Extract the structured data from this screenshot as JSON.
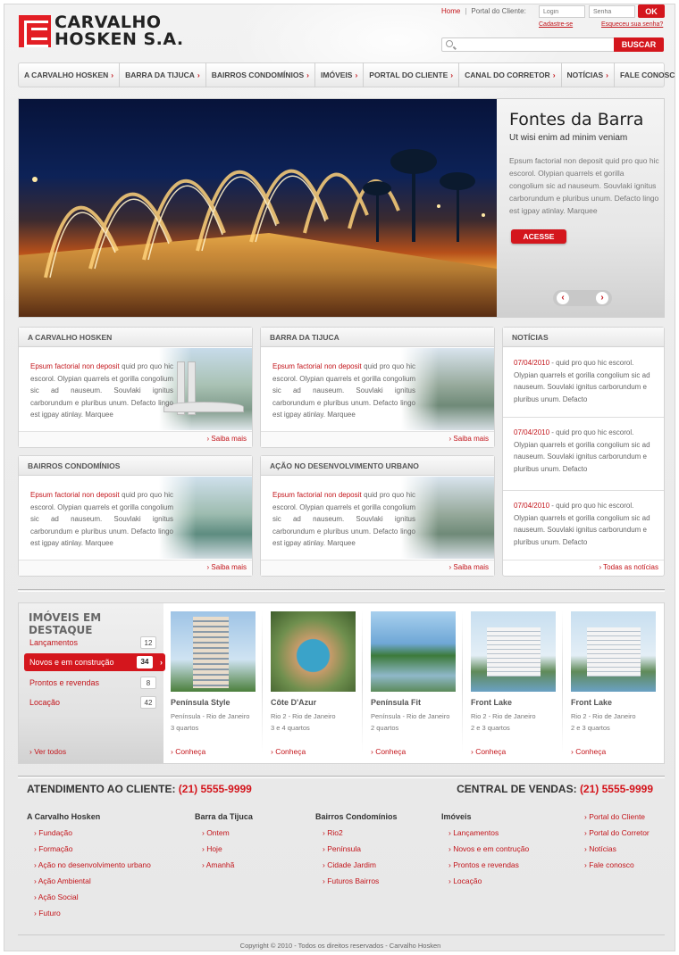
{
  "brand": {
    "line1": "CARVALHO",
    "line2": "HOSKEN S.A."
  },
  "top": {
    "home": "Home",
    "sep": "|",
    "portal_label": "Portal do Cliente:",
    "login_placeholder": "Login",
    "senha_placeholder": "Senha",
    "ok": "OK",
    "cadastre": "Cadastre-se",
    "esqueceu": "Esqueceu sua senha?"
  },
  "search": {
    "placeholder": "",
    "button": "BUSCAR"
  },
  "nav": [
    {
      "label": "A CARVALHO HOSKEN"
    },
    {
      "label": "BARRA DA TIJUCA"
    },
    {
      "label": "BAIRROS CONDOMÍNIOS"
    },
    {
      "label": "IMÓVEIS"
    },
    {
      "label": "PORTAL DO CLIENTE"
    },
    {
      "label": "CANAL DO CORRETOR"
    },
    {
      "label": "NOTÍCIAS"
    },
    {
      "label": "FALE CONOSCO"
    }
  ],
  "chevron": "›",
  "hero": {
    "title": "Fontes da Barra",
    "subtitle": "Ut wisi enim ad minim veniam",
    "text": "Epsum factorial non deposit quid pro quo hic escorol. Olypian quarrels et gorilla congolium sic ad nauseum. Souvlaki ignitus carborundum e pluribus unum. Defacto lingo est igpay atinlay. Marquee",
    "button": "ACESSE",
    "prev": "‹",
    "next": "›"
  },
  "boxes": [
    {
      "title": "A CARVALHO HOSKEN",
      "lead": "Epsum factorial non deposit",
      "text": " quid pro quo hic escorol. Olypian quarrels et gorilla congolium sic ad nauseum. Souvlaki ignitus carborundum e pluribus unum. Defacto lingo est igpay atinlay. Marquee",
      "link": "› Saiba mais"
    },
    {
      "title": "BARRA DA TIJUCA",
      "lead": "Epsum factorial non deposit",
      "text": " quid pro quo hic escorol. Olypian quarrels et gorilla congolium sic ad nauseum. Souvlaki ignitus carborundum e pluribus unum. Defacto lingo est igpay atinlay. Marquee",
      "link": "› Saiba mais"
    },
    {
      "title": "BAIRROS CONDOMÍNIOS",
      "lead": "Epsum factorial non deposit",
      "text": " quid pro quo hic escorol. Olypian quarrels et gorilla congolium sic ad nauseum. Souvlaki ignitus carborundum e pluribus unum. Defacto lingo est igpay atinlay. Marquee",
      "link": "› Saiba mais"
    },
    {
      "title": "AÇÃO NO DESENVOLVIMENTO URBANO",
      "lead": "Epsum factorial non deposit",
      "text": " quid pro quo hic escorol. Olypian quarrels et gorilla congolium sic ad nauseum. Souvlaki ignitus carborundum e pluribus unum. Defacto lingo est igpay atinlay. Marquee",
      "link": "› Saiba mais"
    }
  ],
  "noticias": {
    "title": "NOTÍCIAS",
    "items": [
      {
        "date": "07/04/2010",
        "text": " - quid pro quo hic escorol. Olypian quarrels et gorilla congolium sic ad nauseum. Souvlaki ignitus carborundum e pluribus unum. Defacto"
      },
      {
        "date": "07/04/2010",
        "text": " - quid pro quo hic escorol. Olypian quarrels et gorilla congolium sic ad nauseum. Souvlaki ignitus carborundum e pluribus unum. Defacto"
      },
      {
        "date": "07/04/2010",
        "text": " - quid pro quo hic escorol. Olypian quarrels et gorilla congolium sic ad nauseum. Souvlaki ignitus carborundum e pluribus unum. Defacto"
      }
    ],
    "link": "› Todas as notícias"
  },
  "destaque": {
    "title": "IMÓVEIS EM DESTAQUE",
    "categories": [
      {
        "label": "Lançamentos",
        "count": "12"
      },
      {
        "label": "Novos e em construção",
        "count": "34"
      },
      {
        "label": "Prontos e revendas",
        "count": "8"
      },
      {
        "label": "Locação",
        "count": "42"
      }
    ],
    "active_chevron": "›",
    "ver_todos": "› Ver todos",
    "properties": [
      {
        "name": "Península Style",
        "location": "Península - Rio de Janeiro",
        "rooms": "3 quartos",
        "link": "› Conheça"
      },
      {
        "name": "Côte D'Azur",
        "location": "Rio 2 - Rio de Janeiro",
        "rooms": "3 e 4 quartos",
        "link": "› Conheça"
      },
      {
        "name": "Península Fit",
        "location": "Península - Rio de Janeiro",
        "rooms": "2 quartos",
        "link": "› Conheça"
      },
      {
        "name": "Front Lake",
        "location": "Rio 2 - Rio de Janeiro",
        "rooms": "2 e 3 quartos",
        "link": "› Conheça"
      },
      {
        "name": "Front Lake",
        "location": "Rio 2 - Rio de Janeiro",
        "rooms": "2 e 3 quartos",
        "link": "› Conheça"
      }
    ]
  },
  "contact": {
    "atendimento_label": "ATENDIMENTO AO CLIENTE:",
    "atendimento_phone": "(21) 5555-9999",
    "vendas_label": "CENTRAL DE VENDAS:",
    "vendas_phone": "(21) 5555-9999"
  },
  "footer": {
    "columns": [
      {
        "title": "A Carvalho Hosken",
        "links": [
          "› Fundação",
          "› Formação",
          "› Ação no desenvolvimento urbano",
          "› Ação Ambiental",
          "› Ação Social",
          "› Futuro"
        ]
      },
      {
        "title": "Barra da Tijuca",
        "links": [
          "› Ontem",
          "› Hoje",
          "› Amanhã"
        ]
      },
      {
        "title": "Bairros Condomínios",
        "links": [
          "› Rio2",
          "› Península",
          "› Cidade Jardim",
          "› Futuros Bairros"
        ]
      },
      {
        "title": "Imóveis",
        "links": [
          "› Lançamentos",
          "› Novos e em contrução",
          "› Prontos e revendas",
          "› Locação"
        ]
      }
    ],
    "extra_links": [
      "› Portal do Cliente",
      "› Portal do Corretor",
      "› Notícias",
      "› Fale conosco"
    ],
    "copyright": "Copyright ©  2010 - Todos os direitos reservados - Carvalho Hosken"
  },
  "colors": {
    "accent": "#d4161d",
    "link": "#c3151b",
    "text": "#555555",
    "background": "#ececec"
  }
}
